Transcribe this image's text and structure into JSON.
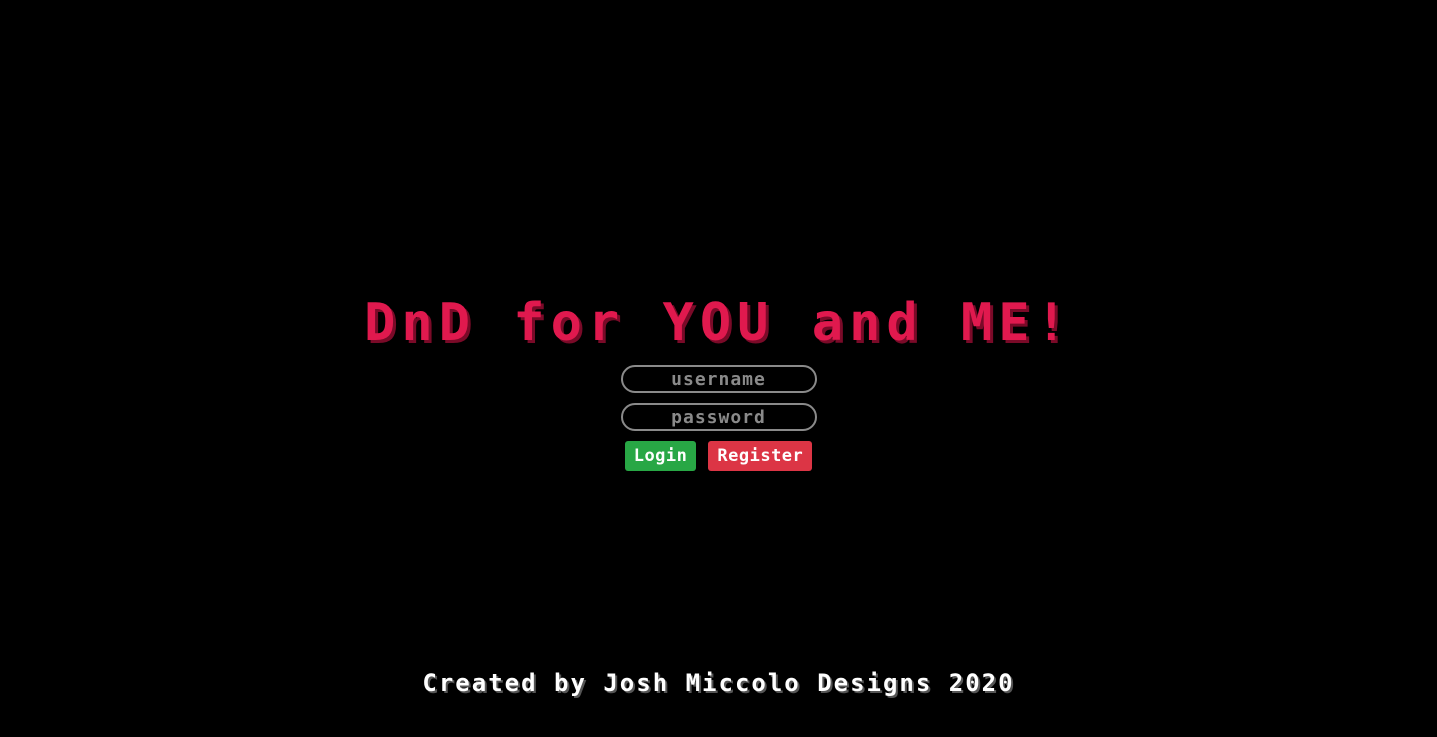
{
  "header": {
    "title": "DnD for YOU and ME!"
  },
  "login_form": {
    "username_placeholder": "username",
    "username_value": "",
    "password_placeholder": "password",
    "password_value": "",
    "login_label": "Login",
    "register_label": "Register"
  },
  "footer": {
    "credit": "Created by Josh Miccolo Designs 2020"
  },
  "colors": {
    "background": "#000000",
    "title": "#e0194e",
    "login_button": "#28a745",
    "register_button": "#dc3545",
    "field_border": "#8a8a8a",
    "footer_text": "#ffffff"
  }
}
